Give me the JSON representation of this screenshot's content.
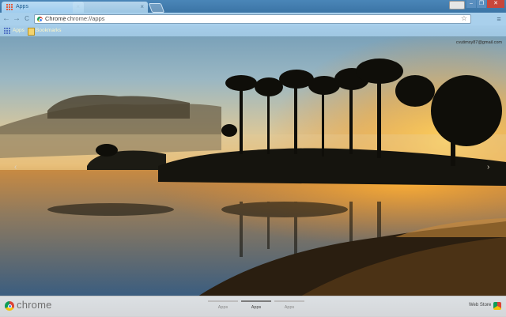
{
  "window": {
    "user_button_label": "",
    "min_label": "–",
    "max_label": "❐",
    "close_label": "✕"
  },
  "tabs": [
    {
      "label": "Apps",
      "active": true
    },
    {
      "label": "",
      "active": false
    }
  ],
  "toolbar": {
    "back_icon": "←",
    "forward_icon": "→",
    "reload_icon": "C",
    "omnibox_site": "Chrome",
    "omnibox_sep": "|",
    "omnibox_url": "chrome://apps",
    "star_icon": "☆",
    "menu_icon": "≡"
  },
  "bookmarks": {
    "items": [
      {
        "label": "Apps",
        "icon": "apps-grid-icon"
      },
      {
        "label": "Bookmarks",
        "icon": "folder-icon"
      }
    ]
  },
  "content": {
    "account_email": "cvutimxy87@gmail.com",
    "prev_arrow": "‹",
    "next_arrow": "›"
  },
  "footer": {
    "brand": "chrome",
    "pages": [
      {
        "label": "Apps",
        "active": false
      },
      {
        "label": "Apps",
        "active": true
      },
      {
        "label": "Apps",
        "active": false
      }
    ],
    "webstore_label": "Web Store"
  },
  "colors": {
    "tab_strip": "#3b74a5",
    "toolbar": "#a9d0ec",
    "close_button": "#c8473b"
  }
}
